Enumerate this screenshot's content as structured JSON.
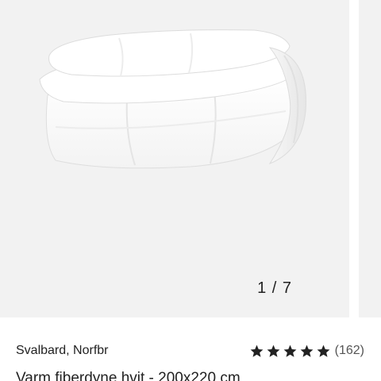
{
  "gallery": {
    "counter": "1 / 7",
    "image_alt": "Varm fiberdyne hvit"
  },
  "product": {
    "brand_line": "Svalbard, Norfbr",
    "rating": {
      "stars": 5,
      "max_stars": 5,
      "count_label": "(162)",
      "star_color": "#222222"
    },
    "title": "Varm fiberdyne hvit - 200x220 cm"
  }
}
